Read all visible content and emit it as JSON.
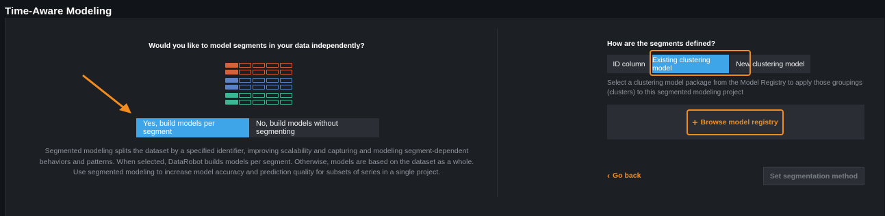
{
  "header": {
    "title": "Time-Aware Modeling"
  },
  "left": {
    "question": "Would you like to model segments in your data independently?",
    "yes_label": "Yes, build models per segment",
    "no_label": "No, build models without segmenting",
    "description": "Segmented modeling splits the dataset by a specified identifier, improving scalability and capturing and modeling segment-dependent behaviors and patterns. When selected, DataRobot builds models per segment. Otherwise, models are based on the dataset as a whole. Use segmented modeling to increase model accuracy and prediction quality for subsets of series in a single project.",
    "illustration_colors": [
      "#d4623a",
      "#5b82c2",
      "#3ab896"
    ]
  },
  "right": {
    "question": "How are the segments defined?",
    "tabs": [
      "ID column",
      "Existing clustering model",
      "New clustering model"
    ],
    "selected_tab": "Existing clustering model",
    "description": "Select a clustering model package from the Model Registry to apply those groupings (clusters) to this segmented modeling project",
    "browse_label": "Browse model registry",
    "go_back_label": "Go back",
    "set_label": "Set segmentation method"
  },
  "colors": {
    "accent_blue": "#3ea6e8",
    "accent_orange": "#f28c1e",
    "background": "#1c1f24"
  }
}
